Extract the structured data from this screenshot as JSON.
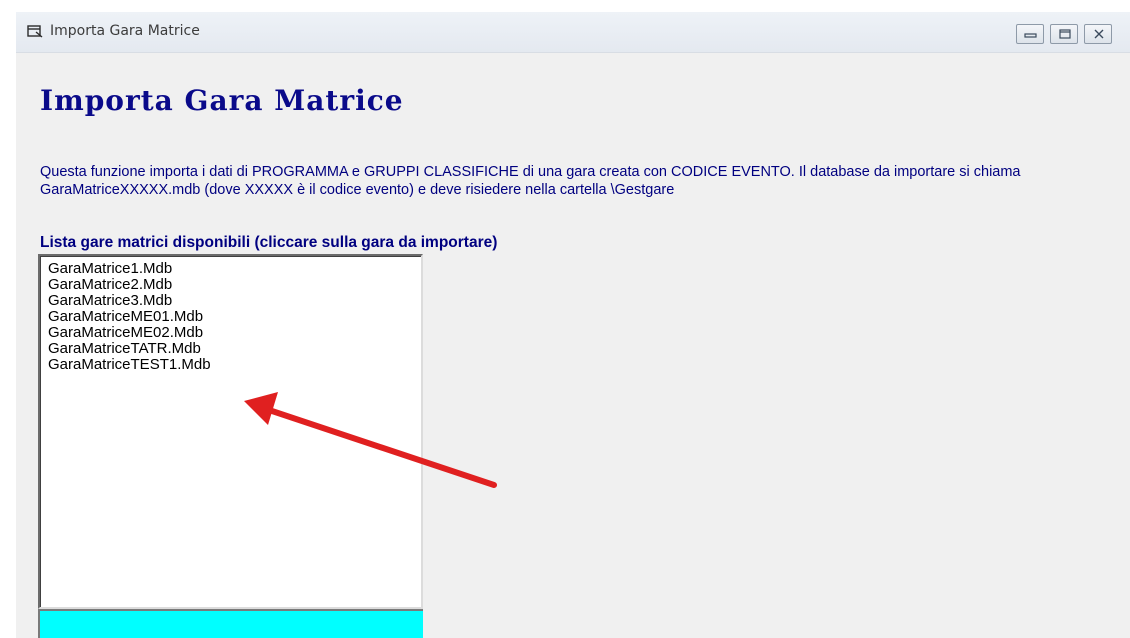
{
  "window": {
    "title": "Importa Gara Matrice",
    "controls": [
      "minimize-icon",
      "maximize-icon",
      "close-icon"
    ]
  },
  "main": {
    "heading": "Importa Gara Matrice",
    "description": "Questa funzione importa i dati di PROGRAMMA e GRUPPI CLASSIFICHE di una gara creata con CODICE EVENTO. Il database da importare si chiama GaraMatriceXXXXX.mdb (dove XXXXX è il codice evento) e deve risiedere nella cartella \\Gestgare",
    "list_label": "Lista gare matrici disponibili (cliccare sulla gara da importare)",
    "list_items": [
      "GaraMatrice1.Mdb",
      "GaraMatrice2.Mdb",
      "GaraMatrice3.Mdb",
      "GaraMatriceME01.Mdb",
      "GaraMatriceME02.Mdb",
      "GaraMatriceTATR.Mdb",
      "GaraMatriceTEST1.Mdb"
    ]
  },
  "colors": {
    "heading": "#0a0a8a",
    "text": "#000080",
    "progress_bar": "#00ffff",
    "annotation_arrow": "#e02020"
  }
}
